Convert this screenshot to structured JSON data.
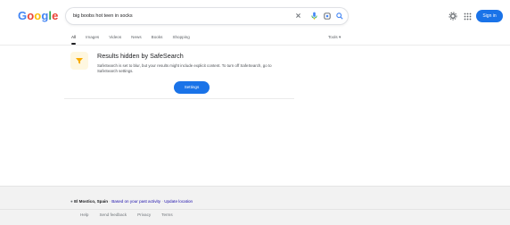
{
  "header": {
    "logo_letters": [
      "G",
      "o",
      "o",
      "g",
      "l",
      "e"
    ],
    "logo_colors": [
      "#4285f4",
      "#ea4335",
      "#fbbc05",
      "#4285f4",
      "#34a853",
      "#ea4335"
    ],
    "search": {
      "query": "big boobs hot teen in socks",
      "icons": [
        "clear-icon",
        "mic-icon",
        "lens-icon",
        "search-icon"
      ]
    },
    "settings_icon": "gear-icon",
    "apps_icon": "apps-grid-icon",
    "sign_in_label": "Sign in"
  },
  "tabs": {
    "items": [
      {
        "label": "All",
        "active": true
      },
      {
        "label": "Images",
        "active": false
      },
      {
        "label": "Videos",
        "active": false
      },
      {
        "label": "News",
        "active": false
      },
      {
        "label": "Books",
        "active": false
      },
      {
        "label": "Shopping",
        "active": false
      }
    ],
    "tools_label": "Tools"
  },
  "safesearch": {
    "icon": "safesearch-filter-icon",
    "title": "Results hidden by SafeSearch",
    "description": "SafeSearch is set to blur, but your results might include explicit content. To turn off SafeSearch, go to SafeSearch settings.",
    "button_label": "Settings"
  },
  "footer": {
    "location_place": "El Mostico, Spain",
    "location_separator": " · ",
    "location_source": "Based on your past activity",
    "update_location_label": "Update location",
    "links": [
      "Help",
      "Send feedback",
      "Privacy",
      "Terms"
    ]
  },
  "colors": {
    "accent": "#1a73e8",
    "link": "#1a0dab",
    "footer_bg": "#f2f2f2",
    "icon_box_bg": "#fef7e0"
  }
}
